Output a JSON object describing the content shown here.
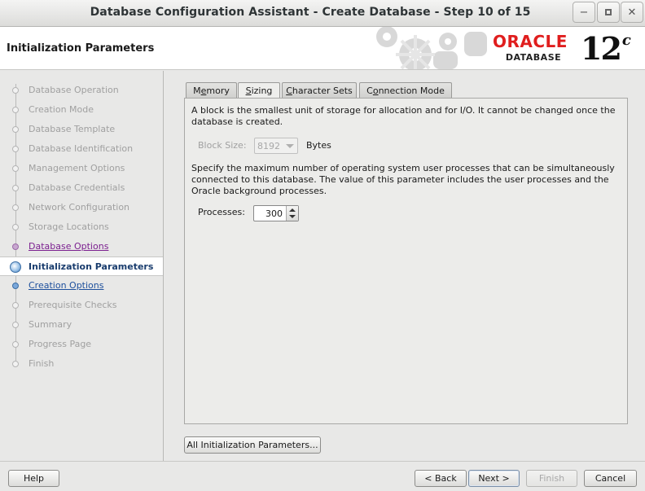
{
  "window": {
    "title": "Database Configuration Assistant - Create Database - Step 10 of 15"
  },
  "header": {
    "page_title": "Initialization Parameters",
    "logo_oracle": "ORACLE",
    "logo_sub": "DATABASE",
    "logo_version": "12",
    "logo_version_suffix": "c",
    "brand_color": "#e01e1e"
  },
  "steps": [
    {
      "label": "Database Operation",
      "state": "disabled"
    },
    {
      "label": "Creation Mode",
      "state": "disabled"
    },
    {
      "label": "Database Template",
      "state": "disabled"
    },
    {
      "label": "Database Identification",
      "state": "disabled"
    },
    {
      "label": "Management Options",
      "state": "disabled"
    },
    {
      "label": "Database Credentials",
      "state": "disabled"
    },
    {
      "label": "Network Configuration",
      "state": "disabled"
    },
    {
      "label": "Storage Locations",
      "state": "disabled"
    },
    {
      "label": "Database Options",
      "state": "visited"
    },
    {
      "label": "Initialization Parameters",
      "state": "current"
    },
    {
      "label": "Creation Options",
      "state": "next"
    },
    {
      "label": "Prerequisite Checks",
      "state": "disabled"
    },
    {
      "label": "Summary",
      "state": "disabled"
    },
    {
      "label": "Progress Page",
      "state": "disabled"
    },
    {
      "label": "Finish",
      "state": "disabled"
    }
  ],
  "tabs": [
    {
      "label": "Memory",
      "mnemonic_index": 1,
      "active": false
    },
    {
      "label": "Sizing",
      "mnemonic_index": 0,
      "active": true
    },
    {
      "label": "Character Sets",
      "mnemonic_index": 0,
      "active": false
    },
    {
      "label": "Connection Mode",
      "mnemonic_index": 1,
      "active": false
    }
  ],
  "sizing": {
    "block_desc_line1": "A block is the smallest unit of storage for allocation and for I/O. It cannot be changed once the",
    "block_desc_line2": "database is created.",
    "block_size_label": "Block Size:",
    "block_size_value": "8192",
    "block_size_unit": "Bytes",
    "proc_desc_line1": "Specify the maximum number of operating system user processes that can be simultaneously",
    "proc_desc_line2": "connected to this database. The value of this parameter includes the user processes and the",
    "proc_desc_line3": "Oracle background processes.",
    "processes_label": "Processes:",
    "processes_value": "300"
  },
  "buttons": {
    "all_params": "All Initialization Parameters...",
    "help": "Help",
    "back": "< Back",
    "next": "Next >",
    "finish": "Finish",
    "cancel": "Cancel"
  },
  "window_controls": {
    "minimize": "minimize-icon",
    "maximize": "maximize-icon",
    "close": "close-icon"
  }
}
